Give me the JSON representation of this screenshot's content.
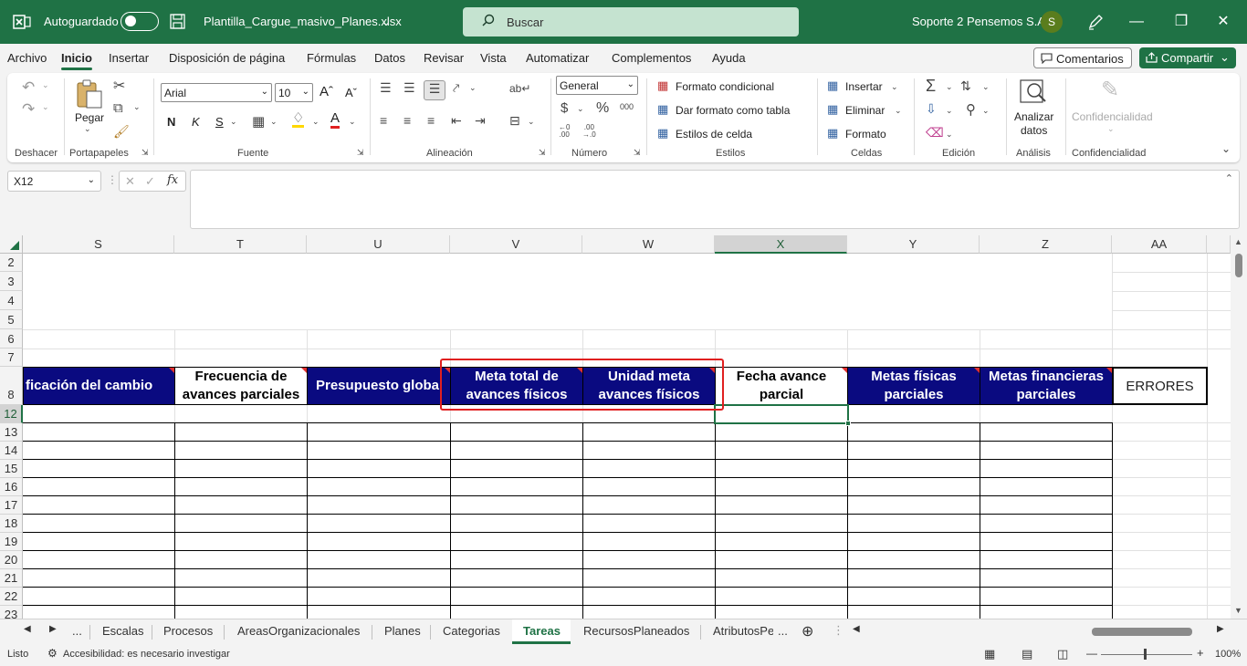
{
  "titlebar": {
    "autosave_label": "Autoguardado",
    "filename": "Plantilla_Cargue_masivo_Planes.xlsx",
    "search_placeholder": "Buscar",
    "user_name": "Soporte 2 Pensemos S.A.",
    "avatar_initial": "S"
  },
  "menu": {
    "items": [
      "Archivo",
      "Inicio",
      "Insertar",
      "Disposición de página",
      "Fórmulas",
      "Datos",
      "Revisar",
      "Vista",
      "Automatizar",
      "Complementos",
      "Ayuda"
    ],
    "active": "Inicio",
    "comments": "Comentarios",
    "share": "Compartir"
  },
  "ribbon": {
    "groups": [
      "Deshacer",
      "Portapapeles",
      "Fuente",
      "Alineación",
      "Número",
      "Estilos",
      "Celdas",
      "Edición",
      "Análisis",
      "Confidencialidad"
    ],
    "paste": "Pegar",
    "font_name": "Arial",
    "font_size": "10",
    "bold": "N",
    "italic": "K",
    "underline": "S",
    "number_format": "General",
    "cond_format": "Formato condicional",
    "table_format": "Dar formato como tabla",
    "cell_styles": "Estilos de celda",
    "insert": "Insertar",
    "delete": "Eliminar",
    "format": "Formato",
    "analyze_1": "Analizar",
    "analyze_2": "datos",
    "confidential": "Confidencialidad"
  },
  "formula_bar": {
    "name_box": "X12",
    "fx": "fx",
    "content": ""
  },
  "columns": [
    "S",
    "T",
    "U",
    "V",
    "W",
    "X",
    "Y",
    "Z",
    "AA"
  ],
  "selected_column": "X",
  "rows": [
    "2",
    "3",
    "4",
    "5",
    "6",
    "7",
    "8",
    "12",
    "13",
    "14",
    "15",
    "16",
    "17",
    "18",
    "19",
    "20",
    "21",
    "22",
    "23"
  ],
  "selected_row": "12",
  "headers": {
    "S": "ficación del cambio",
    "T1": "Frecuencia de",
    "T2": "avances parciales",
    "U": "Presupuesto globa",
    "V1": "Meta total de",
    "V2": "avances físicos",
    "W1": "Unidad meta",
    "W2": "avances físicos",
    "X1": "Fecha avance",
    "X2": "parcial",
    "Y1": "Metas físicas",
    "Y2": "parciales",
    "Z1": "Metas financieras",
    "Z2": "parciales",
    "AA": "ERRORES"
  },
  "colors": {
    "excel_green": "#1f7245",
    "header_blue": "#0a0a80",
    "highlight_red": "#e02020"
  },
  "sheets": {
    "ellipsis": "...",
    "tabs": [
      "Escalas",
      "Procesos",
      "AreasOrganizacionales",
      "Planes",
      "Categorias",
      "Tareas",
      "RecursosPlaneados",
      "AtributosPe"
    ],
    "active": "Tareas",
    "more": "..."
  },
  "status": {
    "ready": "Listo",
    "accessibility": "Accesibilidad: es necesario investigar",
    "zoom": "100%"
  }
}
